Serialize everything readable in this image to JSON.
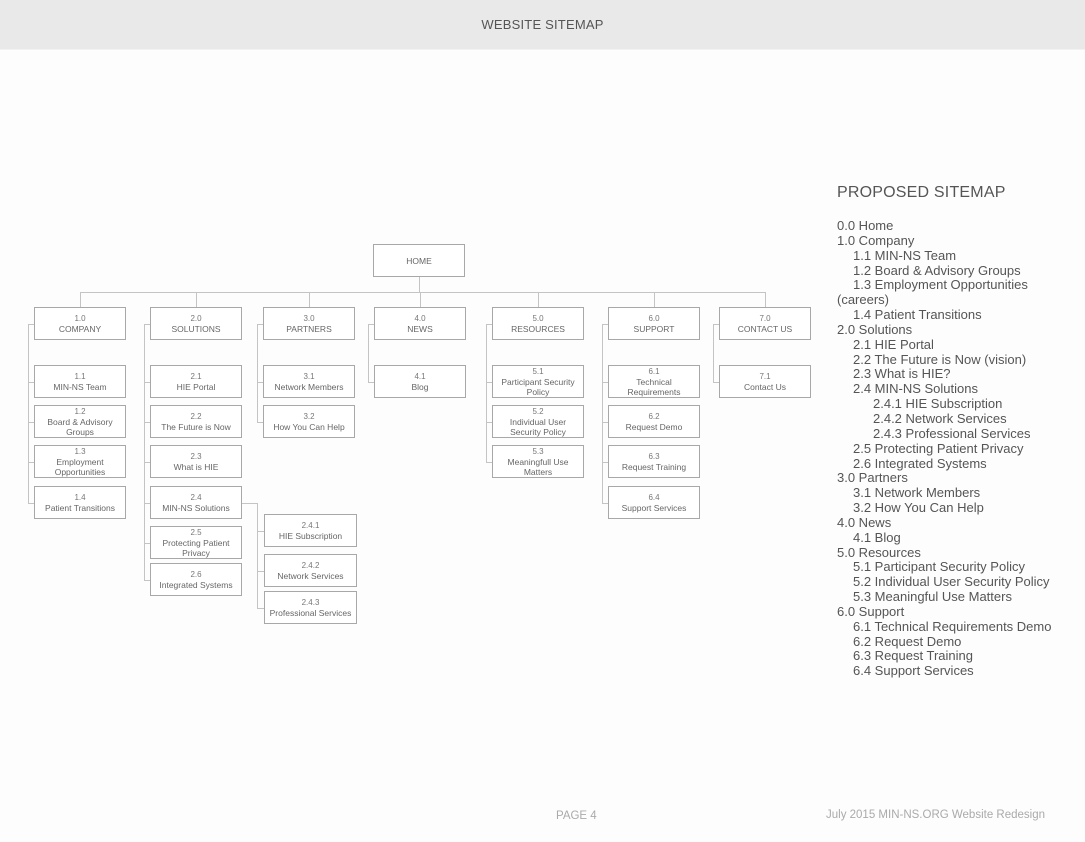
{
  "header": {
    "title": "WEBSITE SITEMAP"
  },
  "diagram": {
    "root": {
      "label": "HOME"
    },
    "sections": [
      {
        "num": "1.0",
        "label": "COMPANY",
        "children": [
          {
            "num": "1.1",
            "label": "MIN-NS Team"
          },
          {
            "num": "1.2",
            "label": "Board & Advisory Groups"
          },
          {
            "num": "1.3",
            "label": "Employment Opportunities"
          },
          {
            "num": "1.4",
            "label": "Patient Transitions"
          }
        ]
      },
      {
        "num": "2.0",
        "label": "SOLUTIONS",
        "children": [
          {
            "num": "2.1",
            "label": "HIE Portal"
          },
          {
            "num": "2.2",
            "label": "The Future is Now"
          },
          {
            "num": "2.3",
            "label": "What is HIE"
          },
          {
            "num": "2.4",
            "label": "MIN-NS Solutions",
            "children": [
              {
                "num": "2.4.1",
                "label": "HIE Subscription"
              },
              {
                "num": "2.4.2",
                "label": "Network Services"
              },
              {
                "num": "2.4.3",
                "label": "Professional Services"
              }
            ]
          },
          {
            "num": "2.5",
            "label": "Protecting Patient Privacy"
          },
          {
            "num": "2.6",
            "label": "Integrated Systems"
          }
        ]
      },
      {
        "num": "3.0",
        "label": "PARTNERS",
        "children": [
          {
            "num": "3.1",
            "label": "Network Members"
          },
          {
            "num": "3.2",
            "label": "How You Can Help"
          }
        ]
      },
      {
        "num": "4.0",
        "label": "NEWS",
        "children": [
          {
            "num": "4.1",
            "label": "Blog"
          }
        ]
      },
      {
        "num": "5.0",
        "label": "RESOURCES",
        "children": [
          {
            "num": "5.1",
            "label": "Participant Security Policy"
          },
          {
            "num": "5.2",
            "label": "Individual User Security Policy"
          },
          {
            "num": "5.3",
            "label": "Meaningfull Use Matters"
          }
        ]
      },
      {
        "num": "6.0",
        "label": "SUPPORT",
        "children": [
          {
            "num": "6.1",
            "label": "Technical Requirements"
          },
          {
            "num": "6.2",
            "label": "Request Demo"
          },
          {
            "num": "6.3",
            "label": "Request Training"
          },
          {
            "num": "6.4",
            "label": "Support Services"
          }
        ]
      },
      {
        "num": "7.0",
        "label": "CONTACT US",
        "children": [
          {
            "num": "7.1",
            "label": "Contact Us"
          }
        ]
      }
    ]
  },
  "sidebar": {
    "title": "PROPOSED SITEMAP",
    "items": [
      {
        "level": 0,
        "text": "0.0 Home"
      },
      {
        "level": 0,
        "text": "1.0 Company"
      },
      {
        "level": 1,
        "text": "1.1 MIN-NS Team"
      },
      {
        "level": 1,
        "text": "1.2 Board & Advisory Groups"
      },
      {
        "level": 1,
        "text": "1.3 Employment Opportunities"
      },
      {
        "level": 0,
        "text": "(careers)"
      },
      {
        "level": 1,
        "text": "1.4 Patient Transitions"
      },
      {
        "level": 0,
        "text": "2.0 Solutions"
      },
      {
        "level": 1,
        "text": "2.1 HIE Portal"
      },
      {
        "level": 1,
        "text": "2.2 The Future is Now (vision)"
      },
      {
        "level": 1,
        "text": "2.3 What is HIE?"
      },
      {
        "level": 1,
        "text": "2.4 MIN-NS Solutions"
      },
      {
        "level": 2,
        "text": "2.4.1 HIE Subscription"
      },
      {
        "level": 2,
        "text": "2.4.2 Network Services"
      },
      {
        "level": 2,
        "text": "2.4.3 Professional Services"
      },
      {
        "level": 1,
        "text": "2.5 Protecting Patient Privacy"
      },
      {
        "level": 1,
        "text": "2.6 Integrated Systems"
      },
      {
        "level": 0,
        "text": "3.0 Partners"
      },
      {
        "level": 1,
        "text": "3.1 Network Members"
      },
      {
        "level": 1,
        "text": "3.2 How You Can Help"
      },
      {
        "level": 0,
        "text": "4.0 News"
      },
      {
        "level": 1,
        "text": "4.1 Blog"
      },
      {
        "level": 0,
        "text": "5.0 Resources"
      },
      {
        "level": 1,
        "text": "5.1 Participant Security Policy"
      },
      {
        "level": 1,
        "text": "5.2 Individual User Security Policy"
      },
      {
        "level": 1,
        "text": "5.3 Meaningful Use Matters"
      },
      {
        "level": 0,
        "text": "6.0 Support"
      },
      {
        "level": 1,
        "text": "6.1 Technical Requirements Demo"
      },
      {
        "level": 1,
        "text": "6.2 Request Demo"
      },
      {
        "level": 1,
        "text": "6.3 Request Training"
      },
      {
        "level": 1,
        "text": "6.4 Support Services"
      }
    ]
  },
  "footer": {
    "page": "PAGE 4",
    "credit": "July 2015 MIN-NS.ORG Website Redesign"
  }
}
